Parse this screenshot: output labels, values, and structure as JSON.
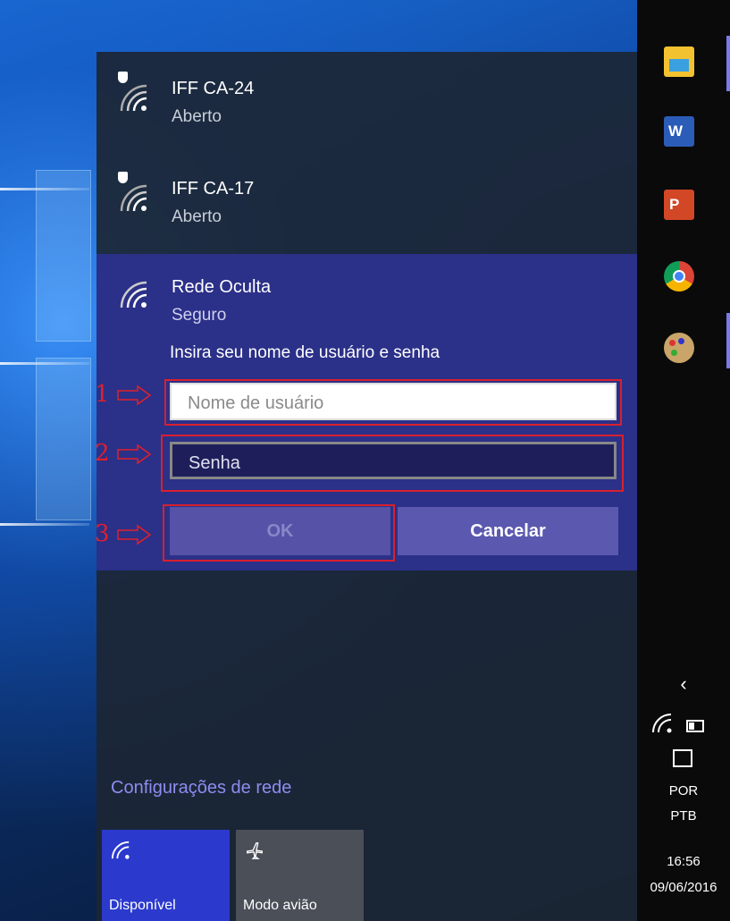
{
  "networks": [
    {
      "name": "IFF CA-24",
      "status": "Aberto"
    },
    {
      "name": "IFF CA-17",
      "status": "Aberto"
    }
  ],
  "expanded_network": {
    "name": "Rede Oculta",
    "status": "Seguro",
    "prompt": "Insira seu nome de usuário e senha",
    "username_placeholder": "Nome de usuário",
    "password_placeholder": "Senha",
    "ok_label": "OK",
    "cancel_label": "Cancelar"
  },
  "annotations": {
    "step1": "1",
    "step2": "2",
    "step3": "3"
  },
  "settings_link": "Configurações de rede",
  "quick_actions": [
    {
      "label": "Disponível",
      "icon": "wifi-icon"
    },
    {
      "label": "Modo avião",
      "icon": "airplane-icon"
    }
  ],
  "taskbar": {
    "pinned": [
      "file-explorer-icon",
      "word-icon",
      "powerpoint-icon",
      "chrome-icon",
      "paint-icon"
    ],
    "language_line1": "POR",
    "language_line2": "PTB",
    "time": "16:56",
    "date": "09/06/2016"
  },
  "colors": {
    "accent": "#2b3088",
    "link": "#8e8cf0",
    "annotation_red": "#d8202e"
  }
}
